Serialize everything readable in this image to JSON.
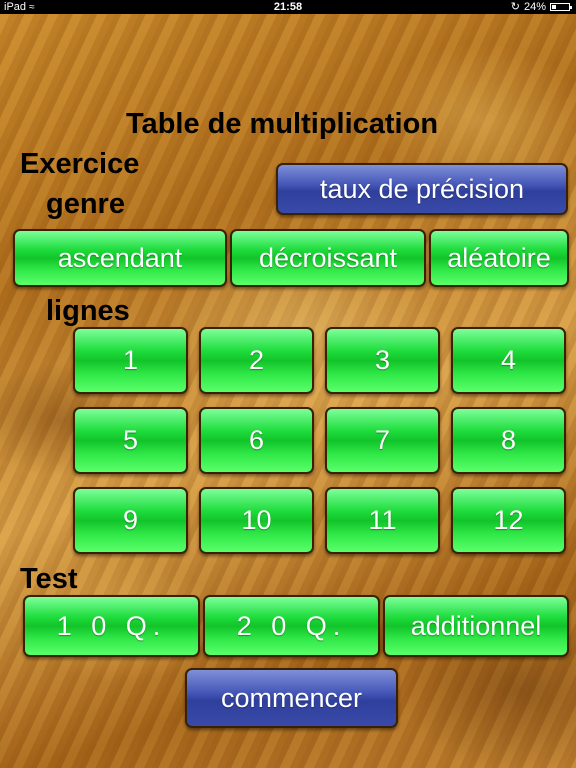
{
  "status_bar": {
    "device": "iPad",
    "time": "21:58",
    "battery": "24%",
    "battery_level": 0.24
  },
  "title": "Table de multiplication",
  "exercise_label_line1": "Exercice",
  "exercise_label_line2": "genre",
  "accuracy_button": "taux de précision",
  "order_buttons": [
    "ascendant",
    "décroissant",
    "aléatoire"
  ],
  "lines_label": "lignes",
  "line_numbers": [
    "1",
    "2",
    "3",
    "4",
    "5",
    "6",
    "7",
    "8",
    "9",
    "10",
    "11",
    "12"
  ],
  "test_label": "Test",
  "test_buttons": [
    "1 0 Q.",
    "2 0 Q.",
    "additionnel"
  ],
  "start_button": "commencer",
  "colors": {
    "green_button": "#1edc3c",
    "blue_button": "#3a4aa8",
    "text": "#000000"
  }
}
